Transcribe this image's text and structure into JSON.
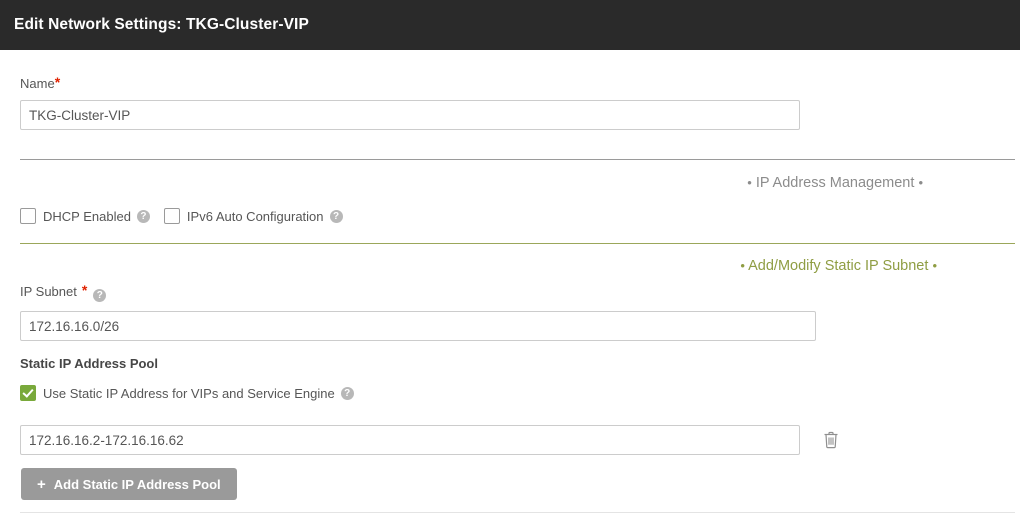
{
  "window": {
    "title": "Edit Network Settings: TKG-Cluster-VIP",
    "header_bg": "#2a2a2a"
  },
  "form": {
    "name_field": {
      "label": "Name",
      "required_marker": "*",
      "value": "TKG-Cluster-VIP"
    },
    "ip_address_management": {
      "legend": "IP Address Management",
      "legend_color": "#8c8c8c",
      "bullet": "•",
      "checkboxes": [
        {
          "label": "DHCP Enabled",
          "checked": false,
          "help_icon": "help-icon"
        },
        {
          "label": "IPv6 Auto Configuration",
          "checked": false,
          "help_icon": "help-icon"
        }
      ]
    },
    "static_ip_subnet": {
      "legend": "Add/Modify Static IP Subnet",
      "legend_color": "#8f9d43",
      "bullet": "•",
      "ip_subnet_field": {
        "label": "IP Subnet",
        "required_marker": "*",
        "value": "172.16.16.0/26"
      },
      "pool_heading": "Static IP Address Pool",
      "use_static_checkbox": {
        "label": "Use Static IP Address for VIPs and Service Engine",
        "checked": true,
        "checked_color": "#79a93b"
      },
      "pool_entries": [
        {
          "value": "172.16.16.2-172.16.16.62",
          "delete_icon": "trash-icon"
        }
      ],
      "add_button": {
        "label": "Add Static IP Address Pool",
        "icon": "plus-icon",
        "bg": "#9a9a9a"
      }
    }
  }
}
